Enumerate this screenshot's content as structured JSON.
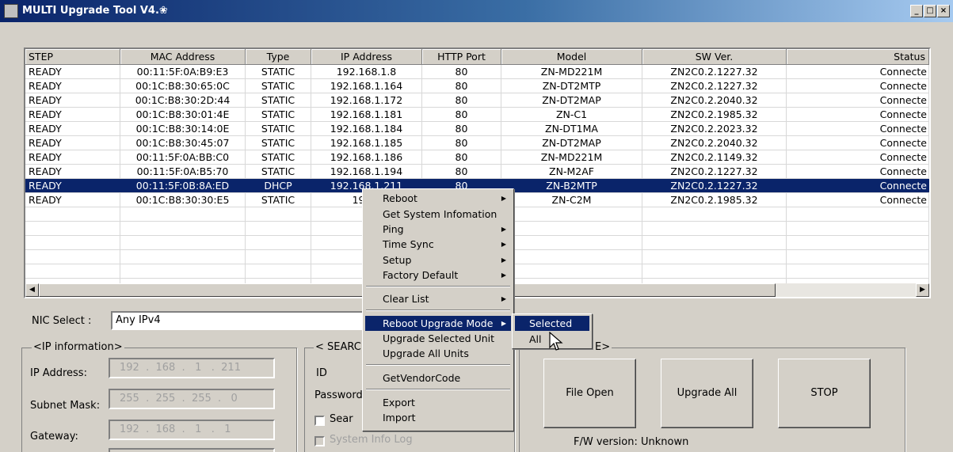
{
  "window": {
    "title": "MULTI Upgrade Tool V4.",
    "title_glyph": "❀",
    "buttons": [
      "_",
      "□",
      "×"
    ]
  },
  "list": {
    "columns": [
      "STEP",
      "MAC Address",
      "Type",
      "IP Address",
      "HTTP Port",
      "Model",
      "SW Ver.",
      "Status"
    ],
    "rows": [
      {
        "step": "READY",
        "mac": "00:11:5F:0A:B9:E3",
        "type": "STATIC",
        "ip": "192.168.1.8",
        "port": "80",
        "model": "ZN-MD221M",
        "sw": "ZN2C0.2.1227.32",
        "status": "Connecte"
      },
      {
        "step": "READY",
        "mac": "00:1C:B8:30:65:0C",
        "type": "STATIC",
        "ip": "192.168.1.164",
        "port": "80",
        "model": "ZN-DT2MTP",
        "sw": "ZN2C0.2.1227.32",
        "status": "Connecte"
      },
      {
        "step": "READY",
        "mac": "00:1C:B8:30:2D:44",
        "type": "STATIC",
        "ip": "192.168.1.172",
        "port": "80",
        "model": "ZN-DT2MAP",
        "sw": "ZN2C0.2.2040.32",
        "status": "Connecte"
      },
      {
        "step": "READY",
        "mac": "00:1C:B8:30:01:4E",
        "type": "STATIC",
        "ip": "192.168.1.181",
        "port": "80",
        "model": "ZN-C1",
        "sw": "ZN2C0.2.1985.32",
        "status": "Connecte"
      },
      {
        "step": "READY",
        "mac": "00:1C:B8:30:14:0E",
        "type": "STATIC",
        "ip": "192.168.1.184",
        "port": "80",
        "model": "ZN-DT1MA",
        "sw": "ZN2C0.2.2023.32",
        "status": "Connecte"
      },
      {
        "step": "READY",
        "mac": "00:1C:B8:30:45:07",
        "type": "STATIC",
        "ip": "192.168.1.185",
        "port": "80",
        "model": "ZN-DT2MAP",
        "sw": "ZN2C0.2.2040.32",
        "status": "Connecte"
      },
      {
        "step": "READY",
        "mac": "00:11:5F:0A:BB:C0",
        "type": "STATIC",
        "ip": "192.168.1.186",
        "port": "80",
        "model": "ZN-MD221M",
        "sw": "ZN2C0.2.1149.32",
        "status": "Connecte"
      },
      {
        "step": "READY",
        "mac": "00:11:5F:0A:B5:70",
        "type": "STATIC",
        "ip": "192.168.1.194",
        "port": "80",
        "model": "ZN-M2AF",
        "sw": "ZN2C0.2.1227.32",
        "status": "Connecte"
      },
      {
        "step": "READY",
        "mac": "00:11:5F:0B:8A:ED",
        "type": "DHCP",
        "ip": "192.168.1.211",
        "port": "80",
        "model": "ZN-B2MTP",
        "sw": "ZN2C0.2.1227.32",
        "status": "Connecte"
      },
      {
        "step": "READY",
        "mac": "00:1C:B8:30:30:E5",
        "type": "STATIC",
        "ip": "192.1",
        "port": "",
        "model": "ZN-C2M",
        "sw": "ZN2C0.2.1985.32",
        "status": "Connecte"
      }
    ],
    "selected_row_index": 8
  },
  "scroll": {
    "left": "◀",
    "right": "▶"
  },
  "nic": {
    "label": "NIC Select :",
    "value": "Any IPv4"
  },
  "ip_info": {
    "title": "<IP information>",
    "ip_label": "IP Address:",
    "ip_value": "192  .  168  .   1   .  211",
    "subnet_label": "Subnet Mask:",
    "subnet_value": "255  .  255  .  255  .   0",
    "gateway_label": "Gateway:",
    "gateway_value": "192  .  168  .   1   .   1"
  },
  "search": {
    "title": "< SEARC",
    "id_label": "ID",
    "password_label": "Password",
    "search_check_label": "Sear",
    "sysinfo_check_label": "System Info Log"
  },
  "upgrade": {
    "title_fragment": "E>",
    "file_open": "File Open",
    "upgrade_all": "Upgrade All",
    "stop": "STOP",
    "fw_version": "F/W version: Unknown"
  },
  "context_menu": {
    "items": [
      {
        "label": "Reboot",
        "submenu": true
      },
      {
        "label": "Get System Infomation",
        "submenu": false
      },
      {
        "label": "Ping",
        "submenu": true
      },
      {
        "label": "Time Sync",
        "submenu": true
      },
      {
        "label": "Setup",
        "submenu": true
      },
      {
        "label": "Factory Default",
        "submenu": true
      },
      {
        "label": "Clear List",
        "submenu": true
      },
      {
        "label": "Reboot Upgrade Mode",
        "submenu": true
      },
      {
        "label": "Upgrade Selected Unit",
        "submenu": false
      },
      {
        "label": "Upgrade All Units",
        "submenu": false
      },
      {
        "label": "GetVendorCode",
        "submenu": false
      },
      {
        "label": "Export",
        "submenu": false
      },
      {
        "label": "Import",
        "submenu": false
      }
    ],
    "highlighted_index": 7
  },
  "submenu": {
    "items": [
      "Selected",
      "All"
    ],
    "highlighted_index": 0
  },
  "icons": {
    "arrow": "▶"
  },
  "colors": {
    "selection": "#0a246a",
    "face": "#d4d0c8"
  }
}
